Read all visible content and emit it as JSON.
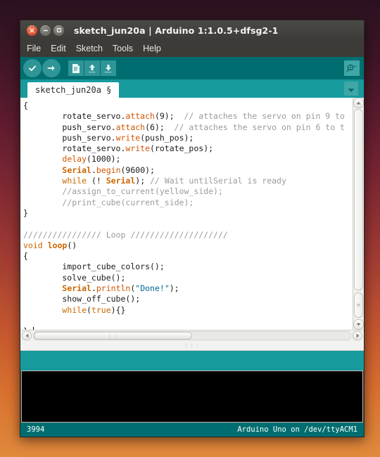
{
  "window": {
    "title": "sketch_jun20a | Arduino 1:1.0.5+dfsg2-1",
    "controls": {
      "close": "×",
      "minimize": "−",
      "maximize": "□"
    }
  },
  "menu": {
    "items": [
      {
        "label": "File"
      },
      {
        "label": "Edit"
      },
      {
        "label": "Sketch"
      },
      {
        "label": "Tools"
      },
      {
        "label": "Help"
      }
    ]
  },
  "toolbar": {
    "verify_label": "Verify",
    "upload_label": "Upload",
    "new_label": "New",
    "open_label": "Open",
    "save_label": "Save",
    "serial_monitor_label": "Serial Monitor"
  },
  "tabs": {
    "active": "sketch_jun20a §",
    "menu_glyph": "▼"
  },
  "editor": {
    "lines": [
      [
        {
          "t": "{",
          "c": ""
        }
      ],
      [
        {
          "t": "        rotate_servo.",
          "c": ""
        },
        {
          "t": "attach",
          "c": "fn"
        },
        {
          "t": "(9);  ",
          "c": ""
        },
        {
          "t": "// attaches the servo on pin 9 to",
          "c": "cm"
        }
      ],
      [
        {
          "t": "        push_servo.",
          "c": ""
        },
        {
          "t": "attach",
          "c": "fn"
        },
        {
          "t": "(6);  ",
          "c": ""
        },
        {
          "t": "// attaches the servo on pin 6 to t",
          "c": "cm"
        }
      ],
      [
        {
          "t": "        push_servo.",
          "c": ""
        },
        {
          "t": "write",
          "c": "fn"
        },
        {
          "t": "(push_pos);",
          "c": ""
        }
      ],
      [
        {
          "t": "        rotate_servo.",
          "c": ""
        },
        {
          "t": "write",
          "c": "fn"
        },
        {
          "t": "(rotate_pos);",
          "c": ""
        }
      ],
      [
        {
          "t": "        ",
          "c": ""
        },
        {
          "t": "delay",
          "c": "fn"
        },
        {
          "t": "(1000);",
          "c": ""
        }
      ],
      [
        {
          "t": "        ",
          "c": ""
        },
        {
          "t": "Serial",
          "c": "kwb"
        },
        {
          "t": ".",
          "c": ""
        },
        {
          "t": "begin",
          "c": "fn"
        },
        {
          "t": "(9600);",
          "c": ""
        }
      ],
      [
        {
          "t": "        ",
          "c": ""
        },
        {
          "t": "while",
          "c": "kw"
        },
        {
          "t": " (! ",
          "c": ""
        },
        {
          "t": "Serial",
          "c": "kwb"
        },
        {
          "t": "); ",
          "c": ""
        },
        {
          "t": "// Wait untilSerial is ready",
          "c": "cm"
        }
      ],
      [
        {
          "t": "        ",
          "c": ""
        },
        {
          "t": "//assign_to_current(yellow_side);",
          "c": "cm"
        }
      ],
      [
        {
          "t": "        ",
          "c": ""
        },
        {
          "t": "//print_cube(current_side);",
          "c": "cm"
        }
      ],
      [
        {
          "t": "}",
          "c": ""
        }
      ],
      [
        {
          "t": "",
          "c": ""
        }
      ],
      [
        {
          "t": "//////////////// Loop ////////////////////",
          "c": "cm"
        }
      ],
      [
        {
          "t": "void ",
          "c": "kw"
        },
        {
          "t": "loop",
          "c": "kwb"
        },
        {
          "t": "()",
          "c": ""
        }
      ],
      [
        {
          "t": "{",
          "c": ""
        }
      ],
      [
        {
          "t": "        import_cube_colors();",
          "c": ""
        }
      ],
      [
        {
          "t": "        solve_cube();",
          "c": ""
        }
      ],
      [
        {
          "t": "        ",
          "c": ""
        },
        {
          "t": "Serial",
          "c": "kwb"
        },
        {
          "t": ".",
          "c": ""
        },
        {
          "t": "println",
          "c": "fn"
        },
        {
          "t": "(",
          "c": ""
        },
        {
          "t": "\"Done!\"",
          "c": "st"
        },
        {
          "t": ");",
          "c": ""
        }
      ],
      [
        {
          "t": "        show_off_cube();",
          "c": ""
        }
      ],
      [
        {
          "t": "        ",
          "c": ""
        },
        {
          "t": "while",
          "c": "kw"
        },
        {
          "t": "(",
          "c": ""
        },
        {
          "t": "true",
          "c": "lit"
        },
        {
          "t": "){}",
          "c": ""
        }
      ],
      [
        {
          "t": "",
          "c": ""
        }
      ],
      [
        {
          "t": "};",
          "c": "",
          "caret": true
        }
      ]
    ]
  },
  "console": {
    "text": ""
  },
  "statusbar": {
    "line_number": "3994",
    "board_info": "Arduino Uno on /dev/ttyACM1"
  },
  "colors": {
    "toolbar_teal": "#006e70",
    "tabstrip_teal": "#179a9c",
    "icon_teal": "#2f9596",
    "keyword_orange": "#cc6600",
    "comment_gray": "#9b9b9b",
    "string_blue": "#006699",
    "titlebar_gray": "#3c3b37",
    "console_black": "#000000"
  }
}
